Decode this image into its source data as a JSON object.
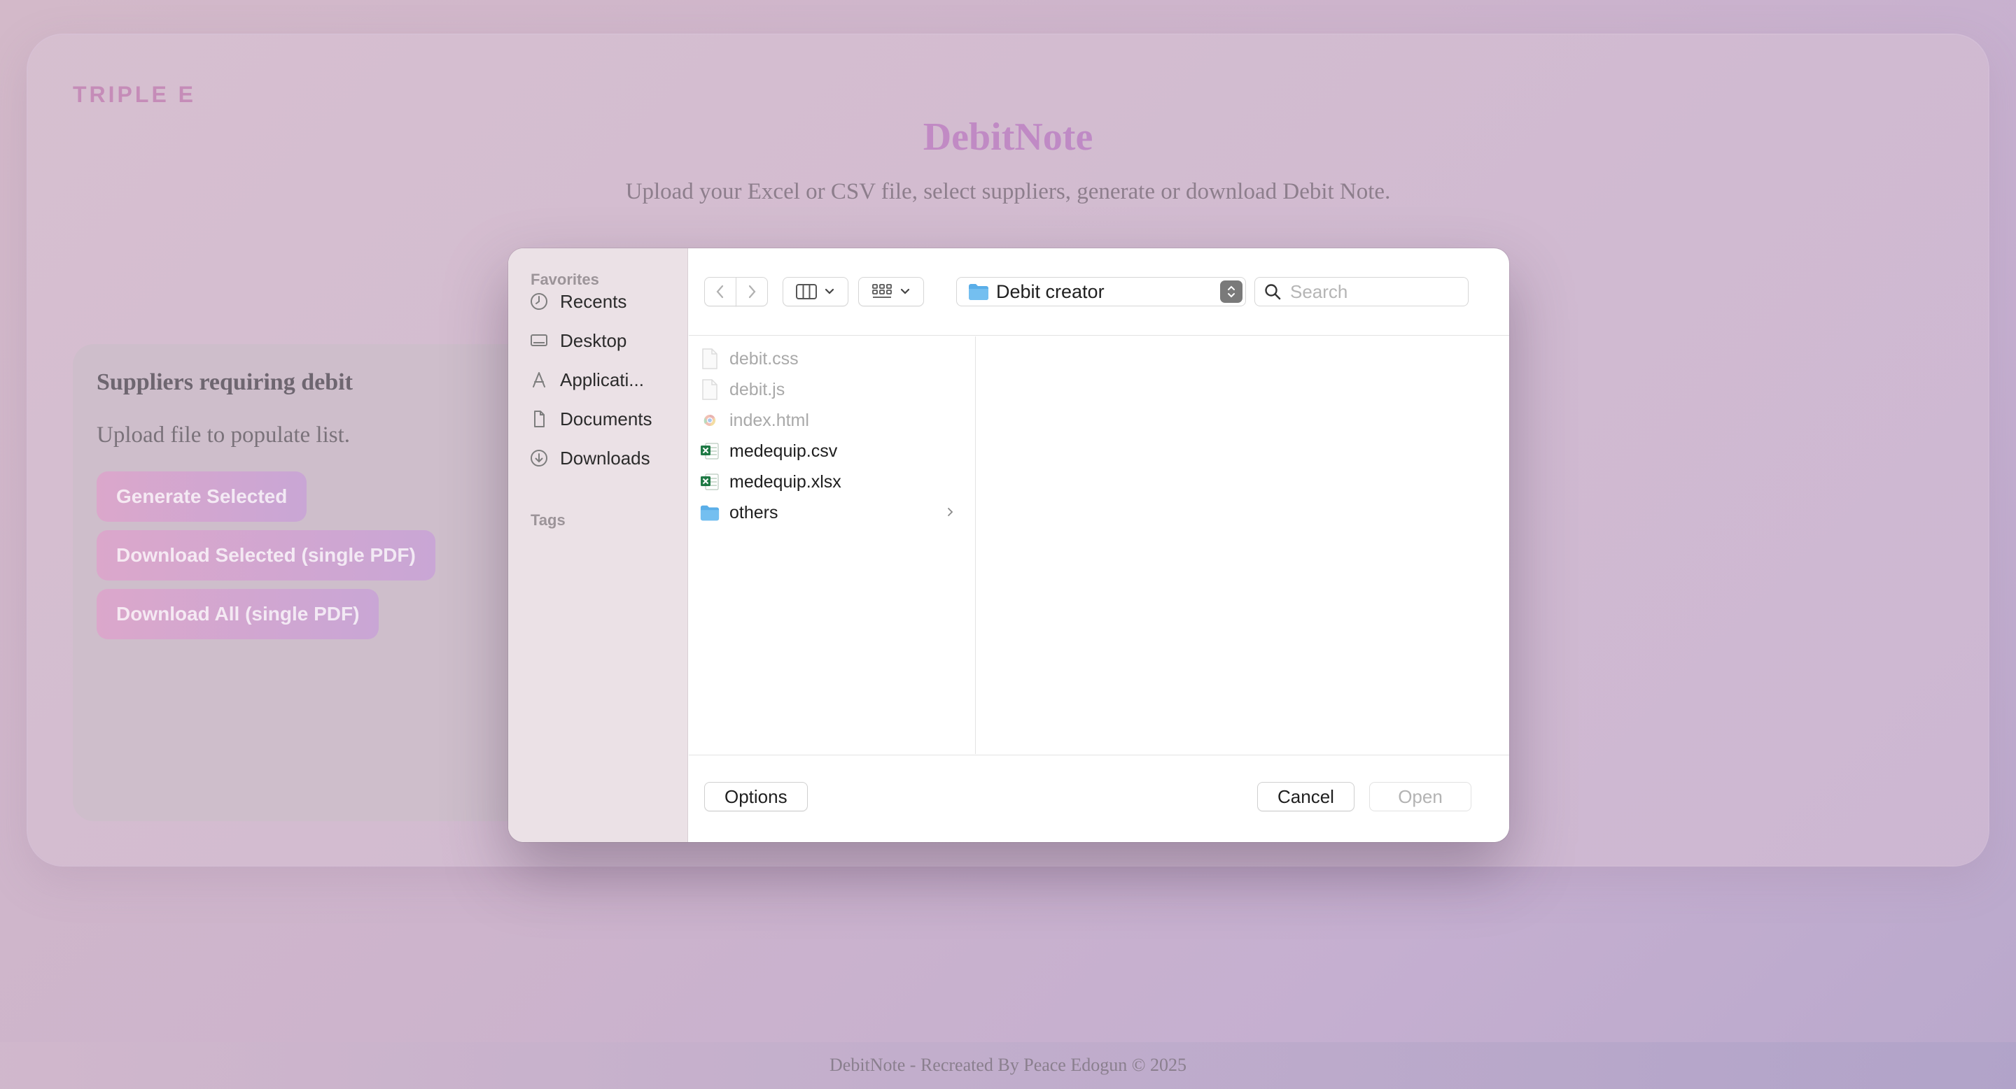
{
  "page": {
    "brand": "TRIPLE E",
    "title": "DebitNote",
    "subtitle": "Upload your Excel or CSV file, select suppliers, generate or download Debit Note.",
    "footer": "DebitNote - Recreated By Peace Edogun © 2025"
  },
  "suppliers_panel": {
    "title": "Suppliers requiring debit",
    "hint": "Upload file to populate list.",
    "buttons": {
      "generate_selected": "Generate Selected",
      "download_selected": "Download Selected (single PDF)",
      "download_all": "Download All (single PDF)"
    }
  },
  "dialog": {
    "sidebar": {
      "favorites_heading": "Favorites",
      "items": [
        {
          "label": "Recents",
          "icon": "clock-icon"
        },
        {
          "label": "Desktop",
          "icon": "desktop-icon"
        },
        {
          "label": "Applicati...",
          "icon": "applications-icon"
        },
        {
          "label": "Documents",
          "icon": "document-icon"
        },
        {
          "label": "Downloads",
          "icon": "download-icon"
        }
      ],
      "tags_heading": "Tags"
    },
    "toolbar": {
      "location": "Debit creator",
      "search_placeholder": "Search"
    },
    "files": [
      {
        "name": "debit.css",
        "type": "file",
        "enabled": false
      },
      {
        "name": "debit.js",
        "type": "file",
        "enabled": false
      },
      {
        "name": "index.html",
        "type": "chrome-html",
        "enabled": false
      },
      {
        "name": "medequip.csv",
        "type": "excel",
        "enabled": true
      },
      {
        "name": "medequip.xlsx",
        "type": "excel",
        "enabled": true
      },
      {
        "name": "others",
        "type": "folder",
        "enabled": true
      }
    ],
    "buttons": {
      "options": "Options",
      "cancel": "Cancel",
      "open": "Open"
    },
    "colors": {
      "folder": "#5aaee8",
      "excel": "#1f7a45",
      "accent_gradient_start": "#d08ab9",
      "accent_gradient_end": "#b08ad0"
    }
  }
}
